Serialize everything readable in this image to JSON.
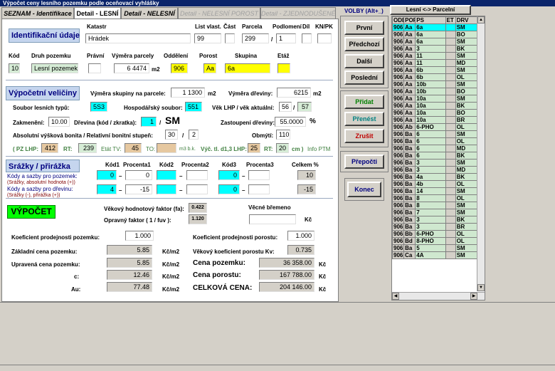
{
  "window": {
    "title": "Výpočet ceny lesního pozemku podle oceňovací vyhlášky"
  },
  "tabs": [
    {
      "label": "SEZNAM - Identifikace",
      "state": "normal"
    },
    {
      "label": "Detail - LESNÍ",
      "state": "active"
    },
    {
      "label": "Detail - NELESNÍ",
      "state": "normal"
    },
    {
      "label": "Detail - NELESNÍ POROST",
      "state": "disabled"
    },
    {
      "label": "Detail - ZJEDNODUŠENÉ",
      "state": "disabled"
    }
  ],
  "ident": {
    "title": "Identifikační údaje",
    "katastr_label": "Katastr",
    "katastr": "Hrádek",
    "list_label": "List vlast.",
    "list": "99",
    "cast_label": "Část",
    "cast": "",
    "parcela_label": "Parcela",
    "parcela": "299",
    "podlomeni_label": "Podlomení",
    "podlomeni": "1",
    "dil_label": "Díl",
    "dil": "",
    "knpk_label": "KN/PK",
    "knpk": "",
    "kod_label": "Kód",
    "kod": "10",
    "druh_label": "Druh pozemku",
    "druh": "Lesní pozemek",
    "pravni_label": "Právní",
    "pravni": "",
    "vymera_label": "Výměra parcely",
    "vymera": "6 4474",
    "vymera_unit": "m2",
    "oddeleni_label": "Oddělení",
    "oddeleni": "906",
    "porost_label": "Porost",
    "porost": "Aa",
    "skupina_label": "Skupina",
    "skupina": "6a",
    "etaz_label": "Etáž",
    "etaz": ""
  },
  "vyp": {
    "title": "Výpočetní veličiny",
    "vymera_skup_label": "Výměra skupiny na parcele:",
    "vymera_skup": "1 1300",
    "vymera_skup_unit": "m2",
    "vymera_dreviny_label": "Výměra dřeviny:",
    "vymera_dreviny": "6215",
    "vymera_dreviny_unit": "m2",
    "soubor_label": "Soubor lesních typů:",
    "soubor": "5S3",
    "hosp_label": "Hospodářský soubor:",
    "hosp": "551",
    "vek_label": "Věk LHP / věk aktuální:",
    "vek1": "56",
    "vek_sep": "/",
    "vek2": "57",
    "zakmeneni_label": "Zakmenění:",
    "zakmeneni": "10.00",
    "drevina_label": "Dřevina (kód / zkratka):",
    "drevina_kod": "1",
    "drevina_sep": "/",
    "drevina_zkr": "SM",
    "zastoupeni_label": "Zastoupení dřeviny:",
    "zastoupeni": "55.0000",
    "zastoupeni_unit": "%",
    "bonita_label": "Absolutní výšková bonita / Relativní bonitní stupeň:",
    "bonita1": "30",
    "bonita_sep": "/",
    "bonita2": "2",
    "obmyti_label": "Obmýtí:",
    "obmyti": "110",
    "pzlhp_label": "( PZ LHP:",
    "pzlhp": "412",
    "rt_label": "RT:",
    "rt": "239",
    "etattv_label": "Etát TV:",
    "etattv": "45",
    "to_label": "TO:",
    "to": "",
    "to_unit": "m3 b.k.",
    "vyc_label": "Výč. tl. d1,3 LHP:",
    "vyc": "25",
    "rt2_label": "RT:",
    "rt2": "20",
    "rt2_unit": "cm )",
    "info_ptm": "Info PTM"
  },
  "srazky": {
    "title": "Srážky / přirážka",
    "h_kod1": "Kód1",
    "h_proc1": "Procenta1",
    "h_kod2": "Kód2",
    "h_proc2": "Procenta2",
    "h_kod3": "Kód3",
    "h_proc3": "Procenta3",
    "h_celkem": "Celkem %",
    "row1_label": "Kódy a sazby pro pozemek:",
    "row1_note": "(Srážky, absolutní hodnota (+))",
    "row2_label": "Kódy a sazby pro dřevinu:",
    "row2_note": "(Srážky (-), přirážka (+))",
    "r1": {
      "kod1": "0",
      "dash1": "–",
      "proc1": "0",
      "kod2": "",
      "dash2": "–",
      "proc2": "",
      "kod3": "0",
      "dash3": "–",
      "proc3": "",
      "celkem": "10"
    },
    "r2": {
      "kod1": "4",
      "dash1": "–",
      "proc1": "-15",
      "kod2": "",
      "dash2": "–",
      "proc2": "",
      "kod3": "0",
      "dash3": "–",
      "proc3": "",
      "celkem": "-15"
    }
  },
  "vypocet": {
    "button": "VÝPOČET",
    "vekovy_label": "Věkový hodnotový faktor (fa):",
    "vekovy": "0.422",
    "opravny_label": "Opravný faktor ( 1 / fuv ):",
    "opravny": "1.120",
    "vecne_label": "Věcné břemeno",
    "vecne": "",
    "vecne_unit": "Kč",
    "koef_poz_label": "Koeficient prodejnosti pozemku:",
    "koef_poz": "1.000",
    "koef_por_label": "Koeficient prodejnosti porostu:",
    "koef_por": "1.000",
    "zakl_label": "Základní cena pozemku:",
    "zakl": "5.85",
    "zakl_unit": "Kč/m2",
    "vekkoef_label": "Věkový koeficient porostu Kv:",
    "vekkoef": "0.735",
    "uprav_label": "Upravená cena pozemku:",
    "uprav": "5.85",
    "uprav_unit": "Kč/m2",
    "cena_poz_label": "Cena pozemku:",
    "cena_poz": "36 358.00",
    "cena_poz_unit": "Kč",
    "c_label": "c:",
    "c": "12.46",
    "c_unit": "Kč/m2",
    "cena_por_label": "Cena porostu:",
    "cena_por": "167 788.00",
    "cena_por_unit": "Kč",
    "au_label": "Au:",
    "au": "77.48",
    "au_unit": "Kč/m2",
    "celk_label": "CELKOVÁ CENA:",
    "celk": "204 146.00",
    "celk_unit": "Kč"
  },
  "nav": {
    "volby_label": "VOLBY (Alt+_)",
    "toggle": "Lesní <-> Parcelní",
    "prvni": "První",
    "predchozi": "Předchozí",
    "dalsi": "Další",
    "posledni": "Poslední",
    "pridat": "Přidat",
    "prenest": "Přenést",
    "zrusit": "Zrušit",
    "prepocti": "Přepočti",
    "konec": "Konec"
  },
  "list": {
    "headers": [
      "ODD",
      "POR",
      "PS",
      "ET",
      "DRV"
    ],
    "rows": [
      [
        "906",
        "Aa",
        "6a",
        "",
        "SM"
      ],
      [
        "906",
        "Aa",
        "6a",
        "",
        "BO"
      ],
      [
        "906",
        "Aa",
        "6a",
        "",
        "SM"
      ],
      [
        "906",
        "Aa",
        "3",
        "",
        "BK"
      ],
      [
        "906",
        "Aa",
        "11",
        "",
        "SM"
      ],
      [
        "906",
        "Aa",
        "11",
        "",
        "MD"
      ],
      [
        "906",
        "Aa",
        "6b",
        "",
        "SM"
      ],
      [
        "906",
        "Aa",
        "6b",
        "",
        "OL"
      ],
      [
        "906",
        "Aa",
        "10b",
        "",
        "SM"
      ],
      [
        "906",
        "Aa",
        "10b",
        "",
        "BO"
      ],
      [
        "906",
        "Aa",
        "10a",
        "",
        "SM"
      ],
      [
        "906",
        "Aa",
        "10a",
        "",
        "BK"
      ],
      [
        "906",
        "Aa",
        "10a",
        "",
        "BO"
      ],
      [
        "906",
        "Aa",
        "10a",
        "",
        "BR"
      ],
      [
        "906",
        "Ab",
        "6-PHO",
        "",
        "OL"
      ],
      [
        "906",
        "Ba",
        "6",
        "",
        "SM"
      ],
      [
        "906",
        "Ba",
        "6",
        "",
        "OL"
      ],
      [
        "906",
        "Ba",
        "6",
        "",
        "MD"
      ],
      [
        "906",
        "Ba",
        "6",
        "",
        "BK"
      ],
      [
        "906",
        "Ba",
        "3",
        "",
        "SM"
      ],
      [
        "906",
        "Ba",
        "3",
        "",
        "MD"
      ],
      [
        "906",
        "Ba",
        "4a",
        "",
        "BK"
      ],
      [
        "906",
        "Ba",
        "4b",
        "",
        "OL"
      ],
      [
        "906",
        "Ba",
        "14",
        "",
        "SM"
      ],
      [
        "906",
        "Ba",
        "8",
        "",
        "OL"
      ],
      [
        "906",
        "Ba",
        "8",
        "",
        "SM"
      ],
      [
        "906",
        "Ba",
        "7",
        "",
        "SM"
      ],
      [
        "906",
        "Ba",
        "3",
        "",
        "BK"
      ],
      [
        "906",
        "Ba",
        "3",
        "",
        "BR"
      ],
      [
        "906",
        "Bb",
        "6-PHO",
        "",
        "OL"
      ],
      [
        "906",
        "Bd",
        "8-PHO",
        "",
        "OL"
      ],
      [
        "906",
        "Ba",
        "5",
        "",
        "SM"
      ],
      [
        "906",
        "Ca",
        "4A",
        "",
        "SM"
      ]
    ]
  }
}
